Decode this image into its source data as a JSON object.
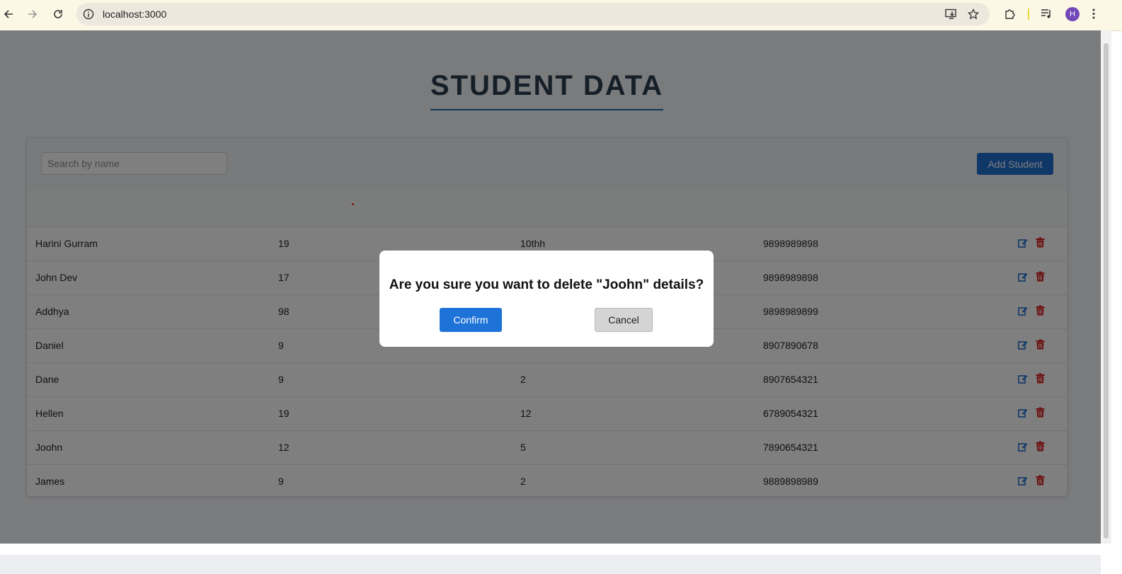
{
  "browser": {
    "url": "localhost:3000",
    "profile_initial": "H"
  },
  "page": {
    "title": "STUDENT DATA",
    "search_placeholder": "Search by name",
    "add_button": "Add Student"
  },
  "students": [
    {
      "name": "Harini Gurram",
      "age": "19",
      "grade": "10thh",
      "phone": "9898989898"
    },
    {
      "name": "John Dev",
      "age": "17",
      "grade": "",
      "phone": "9898989898"
    },
    {
      "name": "Addhya",
      "age": "98",
      "grade": "",
      "phone": "9898989899"
    },
    {
      "name": "Daniel",
      "age": "9",
      "grade": "",
      "phone": "8907890678"
    },
    {
      "name": "Dane",
      "age": "9",
      "grade": "2",
      "phone": "8907654321"
    },
    {
      "name": "Hellen",
      "age": "19",
      "grade": "12",
      "phone": "6789054321"
    },
    {
      "name": "Joohn",
      "age": "12",
      "grade": "5",
      "phone": "7890654321"
    },
    {
      "name": "James",
      "age": "9",
      "grade": "2",
      "phone": "9889898989"
    }
  ],
  "modal": {
    "message": "Are you sure you want to delete \"Joohn\" details?",
    "confirm": "Confirm",
    "cancel": "Cancel"
  },
  "colors": {
    "accent": "#1e6fd0",
    "delete": "#d81e1e",
    "edit": "#1e6fd0",
    "title": "#2c3e50"
  }
}
